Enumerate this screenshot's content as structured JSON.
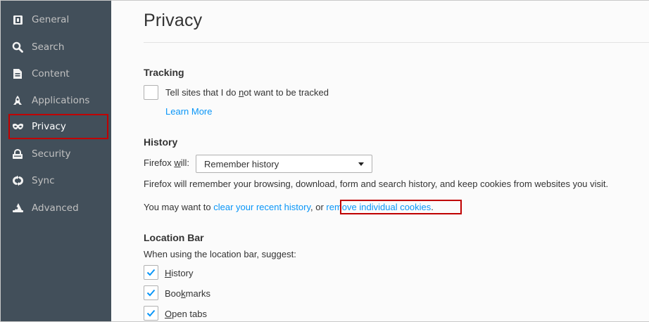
{
  "sidebar": {
    "items": [
      {
        "label": "General",
        "icon": "general-icon"
      },
      {
        "label": "Search",
        "icon": "search-icon"
      },
      {
        "label": "Content",
        "icon": "content-icon"
      },
      {
        "label": "Applications",
        "icon": "applications-icon"
      },
      {
        "label": "Privacy",
        "icon": "privacy-mask-icon",
        "selected": true
      },
      {
        "label": "Security",
        "icon": "security-lock-icon"
      },
      {
        "label": "Sync",
        "icon": "sync-icon"
      },
      {
        "label": "Advanced",
        "icon": "advanced-wizard-icon"
      }
    ]
  },
  "page": {
    "title": "Privacy"
  },
  "tracking": {
    "heading": "Tracking",
    "dnt_label_pre": "Tell sites that I do ",
    "dnt_label_key": "n",
    "dnt_label_post": "ot want to be tracked",
    "dnt_checked": false,
    "learn_more": "Learn More"
  },
  "history": {
    "heading": "History",
    "will_pre": "Firefox ",
    "will_key": "w",
    "will_post": "ill:",
    "select_value": "Remember history",
    "description": "Firefox will remember your browsing, download, form and search history, and keep cookies from websites you visit.",
    "may_want_text": "You may want to ",
    "clear_link": "clear your recent history",
    "or_text": ", or ",
    "cookies_link": "remove individual cookies",
    "period": "."
  },
  "location_bar": {
    "heading": "Location Bar",
    "subtitle": "When using the location bar, suggest:",
    "options": [
      {
        "pre": "",
        "key": "H",
        "post": "istory",
        "checked": true
      },
      {
        "pre": "Boo",
        "key": "k",
        "post": "marks",
        "checked": true
      },
      {
        "pre": "",
        "key": "O",
        "post": "pen tabs",
        "checked": true
      }
    ]
  },
  "colors": {
    "sidebar_bg": "#424f5a",
    "link": "#0996f8",
    "highlight": "#c00000"
  }
}
